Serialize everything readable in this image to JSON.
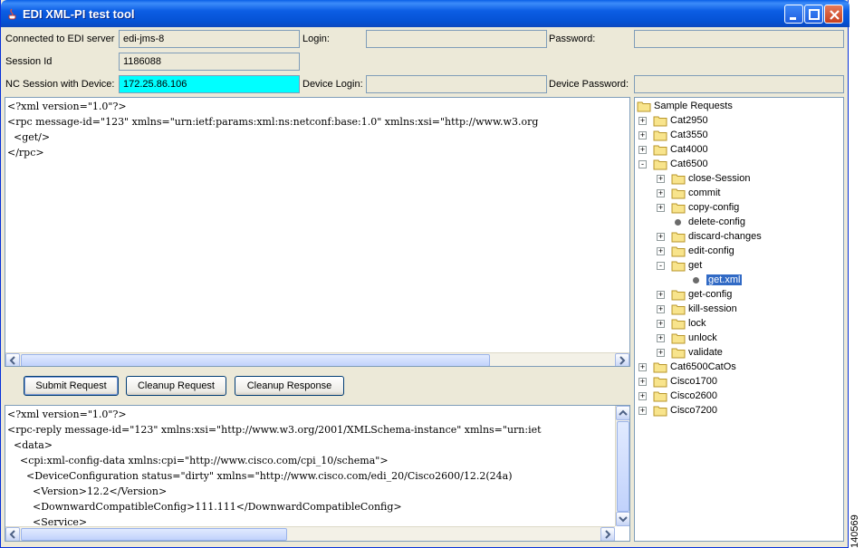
{
  "window": {
    "title": "EDI XML-PI test tool"
  },
  "connection": {
    "connected_label": "Connected to EDI server",
    "connected_value": "edi-jms-8",
    "login_label": "Login:",
    "login_value": "",
    "password_label": "Password:",
    "password_value": "",
    "session_label": "Session Id",
    "session_value": "1186088",
    "nc_label": "NC Session with Device:",
    "nc_value": "172.25.86.106",
    "device_login_label": "Device Login:",
    "device_login_value": "",
    "device_password_label": "Device Password:",
    "device_password_value": ""
  },
  "request_lines": [
    "<?xml version=\"1.0\"?>",
    "<rpc message-id=\"123\" xmlns=\"urn:ietf:params:xml:ns:netconf:base:1.0\" xmlns:xsi=\"http://www.w3.org",
    "  <get/>",
    "</rpc>"
  ],
  "buttons": {
    "submit": "Submit Request",
    "cleanup_request": "Cleanup Request",
    "cleanup_response": "Cleanup Response"
  },
  "response_lines": [
    "<?xml version=\"1.0\"?>",
    "<rpc-reply message-id=\"123\" xmlns:xsi=\"http://www.w3.org/2001/XMLSchema-instance\" xmlns=\"urn:iet",
    "  <data>",
    "    <cpi:xml-config-data xmlns:cpi=\"http://www.cisco.com/cpi_10/schema\">",
    "      <DeviceConfiguration status=\"dirty\" xmlns=\"http://www.cisco.com/edi_20/Cisco2600/12.2(24a)",
    "        <Version>12.2</Version>",
    "        <DownwardCompatibleConfig>111.111</DownwardCompatibleConfig>",
    "        <Service>"
  ],
  "tree": {
    "root": "Sample Requests",
    "nodes": [
      {
        "label": "Cat2950",
        "level": 1,
        "kind": "folder",
        "exp": "+"
      },
      {
        "label": "Cat3550",
        "level": 1,
        "kind": "folder",
        "exp": "+"
      },
      {
        "label": "Cat4000",
        "level": 1,
        "kind": "folder",
        "exp": "+"
      },
      {
        "label": "Cat6500",
        "level": 1,
        "kind": "folder-open",
        "exp": "-"
      },
      {
        "label": "close-Session",
        "level": 2,
        "kind": "folder",
        "exp": "+"
      },
      {
        "label": "commit",
        "level": 2,
        "kind": "folder",
        "exp": "+"
      },
      {
        "label": "copy-config",
        "level": 2,
        "kind": "folder",
        "exp": "+"
      },
      {
        "label": "delete-config",
        "level": 2,
        "kind": "leaf",
        "exp": ""
      },
      {
        "label": "discard-changes",
        "level": 2,
        "kind": "folder",
        "exp": "+"
      },
      {
        "label": "edit-config",
        "level": 2,
        "kind": "folder",
        "exp": "+"
      },
      {
        "label": "get",
        "level": 2,
        "kind": "folder-open",
        "exp": "-"
      },
      {
        "label": "get.xml",
        "level": 3,
        "kind": "leaf",
        "exp": "",
        "selected": true
      },
      {
        "label": "get-config",
        "level": 2,
        "kind": "folder",
        "exp": "+"
      },
      {
        "label": "kill-session",
        "level": 2,
        "kind": "folder",
        "exp": "+"
      },
      {
        "label": "lock",
        "level": 2,
        "kind": "folder",
        "exp": "+"
      },
      {
        "label": "unlock",
        "level": 2,
        "kind": "folder",
        "exp": "+"
      },
      {
        "label": "validate",
        "level": 2,
        "kind": "folder",
        "exp": "+"
      },
      {
        "label": "Cat6500CatOs",
        "level": 1,
        "kind": "folder",
        "exp": "+"
      },
      {
        "label": "Cisco1700",
        "level": 1,
        "kind": "folder",
        "exp": "+"
      },
      {
        "label": "Cisco2600",
        "level": 1,
        "kind": "folder",
        "exp": "+"
      },
      {
        "label": "Cisco7200",
        "level": 1,
        "kind": "folder",
        "exp": "+"
      }
    ]
  },
  "figure_id": "140569",
  "colors": {
    "title_bar": "#0552d4",
    "nc_field": "#00ffff",
    "selection": "#316ac5"
  }
}
